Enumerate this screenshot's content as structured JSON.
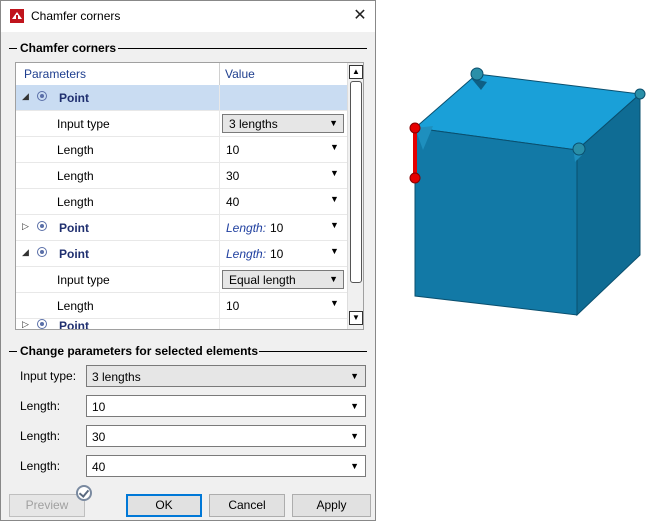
{
  "window": {
    "title": "Chamfer corners",
    "close_glyph": "✕"
  },
  "section1": {
    "legend": "Chamfer corners"
  },
  "grid": {
    "headers": {
      "parameters": "Parameters",
      "value": "Value"
    },
    "rows": {
      "r0": {
        "label": "Point"
      },
      "r1": {
        "label": "Input type",
        "value": "3 lengths"
      },
      "r2": {
        "label": "Length",
        "value": "10"
      },
      "r3": {
        "label": "Length",
        "value": "30"
      },
      "r4": {
        "label": "Length",
        "value": "40"
      },
      "r5": {
        "label": "Point",
        "value_prefix": "Length:",
        "value": "10"
      },
      "r6": {
        "label": "Point",
        "value_prefix": "Length:",
        "value": "10"
      },
      "r7": {
        "label": "Input type",
        "value": "Equal length"
      },
      "r8": {
        "label": "Length",
        "value": "10"
      },
      "r9": {
        "label": "Point"
      }
    }
  },
  "section2": {
    "legend": "Change parameters for selected elements",
    "input_type_label": "Input type:",
    "input_type_value": "3 lengths",
    "length1_label": "Length:",
    "length1_value": "10",
    "length2_label": "Length:",
    "length2_value": "30",
    "length3_label": "Length:",
    "length3_value": "40"
  },
  "buttons": {
    "preview": "Preview",
    "ok": "OK",
    "cancel": "Cancel",
    "apply": "Apply"
  },
  "colors": {
    "cube_front": "#1279a6",
    "cube_top": "#1aa0d8",
    "cube_side": "#0f6c94",
    "selected_edge": "#e60000",
    "handle": "#2a8fa8"
  }
}
